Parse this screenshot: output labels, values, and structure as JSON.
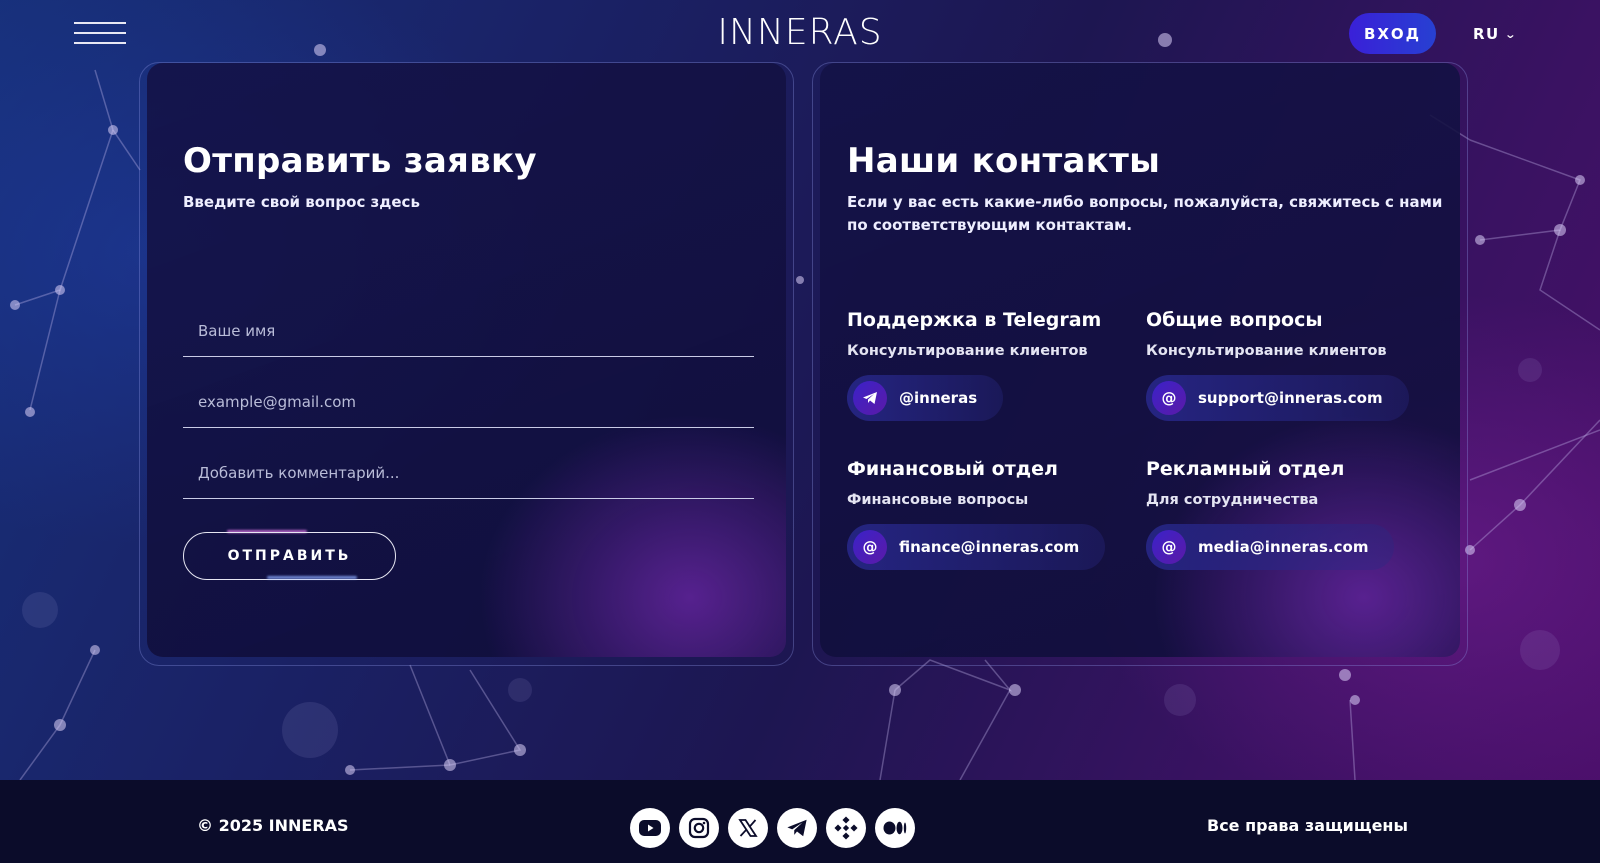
{
  "header": {
    "logo": "INNERAS",
    "login_label": "ВХОД",
    "language": "RU"
  },
  "form": {
    "title": "Отправить заявку",
    "subtitle": "Введите свой вопрос здесь",
    "name_placeholder": "Ваше имя",
    "email_placeholder": "example@gmail.com",
    "comment_placeholder": "Добавить комментарий...",
    "submit_label": "ОТПРАВИТЬ"
  },
  "contacts": {
    "title": "Наши контакты",
    "subtitle_line1": "Если у вас есть какие-либо вопросы, пожалуйста, свяжитесь с нами",
    "subtitle_line2": "по соответствующим контактам.",
    "items": [
      {
        "title": "Поддержка в Telegram",
        "desc": "Консультирование клиентов",
        "value": "@inneras",
        "icon": "telegram-icon"
      },
      {
        "title": "Общие вопросы",
        "desc": "Консультирование клиентов",
        "value": "support@inneras.com",
        "icon": "at-icon"
      },
      {
        "title": "Финансовый отдел",
        "desc": "Финансовые вопросы",
        "value": "finance@inneras.com",
        "icon": "at-icon"
      },
      {
        "title": "Рекламный отдел",
        "desc": "Для сотрудничества",
        "value": "media@inneras.com",
        "icon": "at-icon"
      }
    ]
  },
  "footer": {
    "copyright": "© 2025 INNERAS",
    "rights": "Все права защищены",
    "socials": [
      "youtube-icon",
      "instagram-icon",
      "x-icon",
      "telegram-icon",
      "binance-icon",
      "medium-icon"
    ]
  },
  "colors": {
    "login_button": "#3a20d8",
    "footer_bg": "#0b0c2a",
    "pill_icon": "#3b22c8"
  }
}
